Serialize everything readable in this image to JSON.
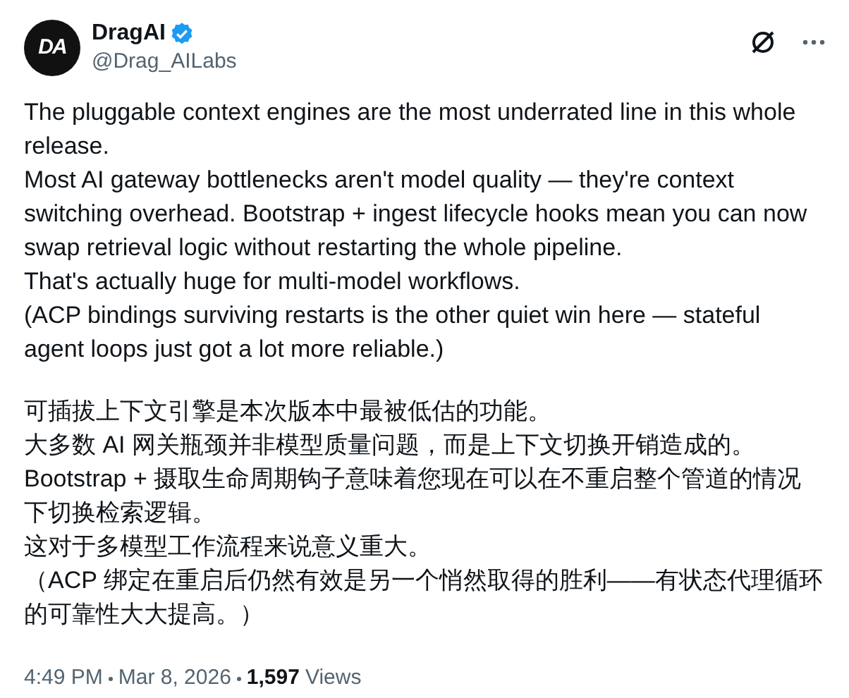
{
  "author": {
    "avatar_text": "DA",
    "name": "DragAI",
    "verified": true,
    "handle": "@Drag_AILabs"
  },
  "paragraphs": [
    [
      "The pluggable context engines are the most underrated line in this whole release.",
      "Most AI gateway bottlenecks aren't model quality — they're context switching overhead. Bootstrap + ingest lifecycle hooks mean you can now swap retrieval logic without restarting the whole pipeline.",
      "That's actually huge for multi-model workflows.",
      "(ACP bindings surviving restarts is the other quiet win here — stateful agent loops just got a lot more reliable.)"
    ],
    [
      "可插拔上下文引擎是本次版本中最被低估的功能。",
      "大多数 AI 网关瓶颈并非模型质量问题，而是上下文切换开销造成的。",
      "Bootstrap + 摄取生命周期钩子意味着您现在可以在不重启整个管道的情况下切换检索逻辑。",
      "这对于多模型工作流程来说意义重大。",
      "（ACP 绑定在重启后仍然有效是另一个悄然取得的胜利——有状态代理循环的可靠性大大提高。）"
    ]
  ],
  "meta": {
    "time": "4:49 PM",
    "date": "Mar 8, 2026",
    "views_count": "1,597",
    "views_label": "Views"
  }
}
